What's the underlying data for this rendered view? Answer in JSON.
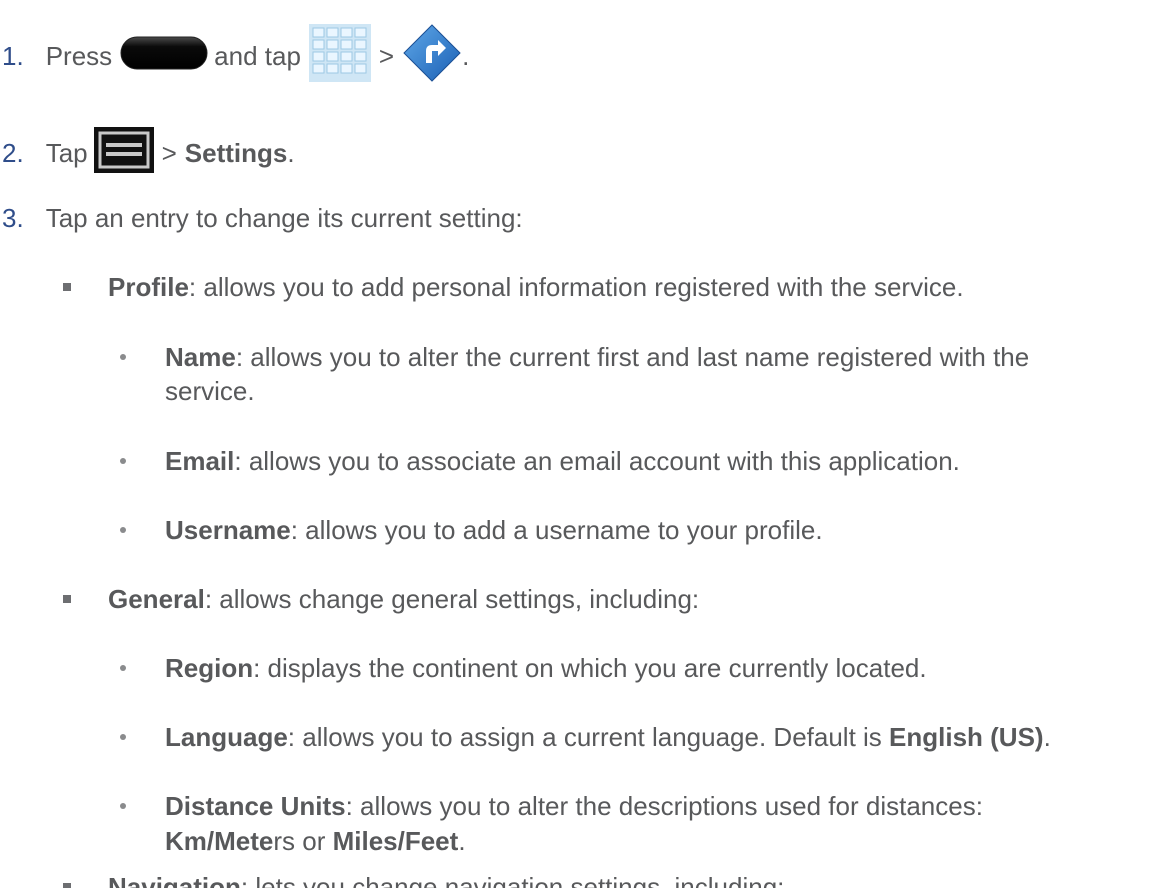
{
  "steps": [
    {
      "number": "1.",
      "text_a": "Press",
      "text_b": "and tap",
      "text_c": ">",
      "text_d": ".",
      "icons": [
        "home-key-icon",
        "apps-grid-icon",
        "navigation-app-icon"
      ]
    },
    {
      "number": "2.",
      "text_a": "Tap",
      "text_b": ">",
      "bold": "Settings",
      "text_c": ".",
      "icons": [
        "menu-key-icon"
      ]
    },
    {
      "number": "3.",
      "text": "Tap an entry to change its current setting:"
    }
  ],
  "profile": {
    "label": "Profile",
    "desc": ": allows you to add personal information registered with the service.",
    "name": {
      "label": "Name",
      "desc_1": ": allows you to alter the current first and last name registered with the",
      "desc_2": "service."
    },
    "email": {
      "label": "Email",
      "desc": ": allows you to associate an email account with this application."
    },
    "username": {
      "label": "Username",
      "desc": ": allows you to add a username to your profile."
    }
  },
  "general": {
    "label": "General",
    "desc": ": allows change general settings, including:",
    "region": {
      "label": "Region",
      "desc": ": displays the continent on which you are currently located."
    },
    "language": {
      "label": "Language",
      "desc": ": allows you to assign a current language. Default is ",
      "default_value": "English (US)",
      "end": "."
    },
    "distance": {
      "label": "Distance Units",
      "desc": ": allows you to alter the descriptions used for distances:",
      "opt1_bold": "Km/Mete",
      "opt1_rest": "rs or ",
      "opt2_bold": "Miles/Feet",
      "end": "."
    }
  },
  "navigation": {
    "label": "Navigation",
    "desc": ": lets you change navigation settings, including:"
  }
}
